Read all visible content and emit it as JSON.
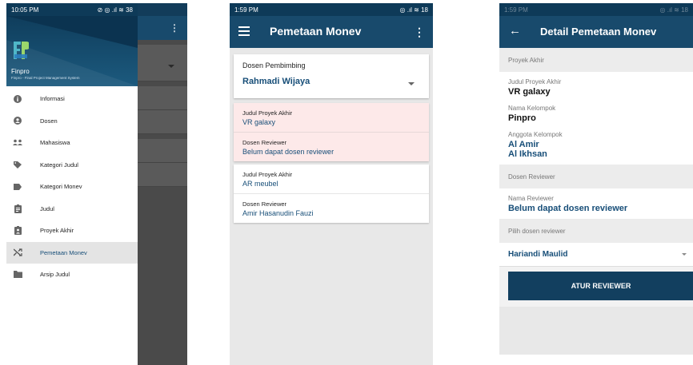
{
  "colors": {
    "primary": "#184a6c",
    "status_bar": "#0e3a58",
    "accent_text": "#174e78",
    "highlight_card": "#fde9e9"
  },
  "screen1": {
    "status": {
      "time": "10:05 PM",
      "right": "⊘ ◎ .ıl ≋ 38"
    },
    "app_name": "Finpro",
    "app_subtitle": "Finpro - Final Project Management System",
    "logo_letters": "FP",
    "menu": [
      {
        "label": "Informasi",
        "icon": "info-icon"
      },
      {
        "label": "Dosen",
        "icon": "account-icon"
      },
      {
        "label": "Mahasiswa",
        "icon": "group-icon"
      },
      {
        "label": "Kategori Judul",
        "icon": "tag-icon"
      },
      {
        "label": "Kategori Monev",
        "icon": "label-icon"
      },
      {
        "label": "Judul",
        "icon": "assignment-icon"
      },
      {
        "label": "Proyek Akhir",
        "icon": "assignment-ind-icon"
      },
      {
        "label": "Pemetaan Monev",
        "icon": "shuffle-icon",
        "active": true
      },
      {
        "label": "Arsip Judul",
        "icon": "folder-icon"
      }
    ]
  },
  "screen2": {
    "status": {
      "time": "1:59 PM",
      "right": "◎ .ıl ≋ 18"
    },
    "title": "Pemetaan Monev",
    "selector": {
      "label": "Dosen Pembimbing",
      "value": "Rahmadi Wijaya"
    },
    "projects": [
      {
        "title_label": "Judul Proyek Akhir",
        "title": "VR galaxy",
        "reviewer_label": "Dosen Reviewer",
        "reviewer": "Belum dapat dosen reviewer"
      },
      {
        "title_label": "Judul Proyek Akhir",
        "title": "AR meubel",
        "reviewer_label": "Dosen Reviewer",
        "reviewer": "Amir Hasanudin Fauzi"
      }
    ]
  },
  "screen3": {
    "status": {
      "time": "1:59 PM",
      "right": "◎ .ıl ≋ 18"
    },
    "title": "Detail Pemetaan Monev",
    "section_project": "Proyek Akhir",
    "judul_label": "Judul Proyek Akhir",
    "judul": "VR galaxy",
    "kelompok_label": "Nama Kelompok",
    "kelompok": "Pinpro",
    "anggota_label": "Anggota Kelompok",
    "anggota": [
      "Al Amir",
      "Al Ikhsan"
    ],
    "section_reviewer": "Dosen Reviewer",
    "reviewer_label": "Nama Reviewer",
    "reviewer": "Belum dapat dosen reviewer",
    "section_pick": "Pilih dosen reviewer",
    "pick_value": "Hariandi Maulid",
    "button": "ATUR REVIEWER"
  }
}
